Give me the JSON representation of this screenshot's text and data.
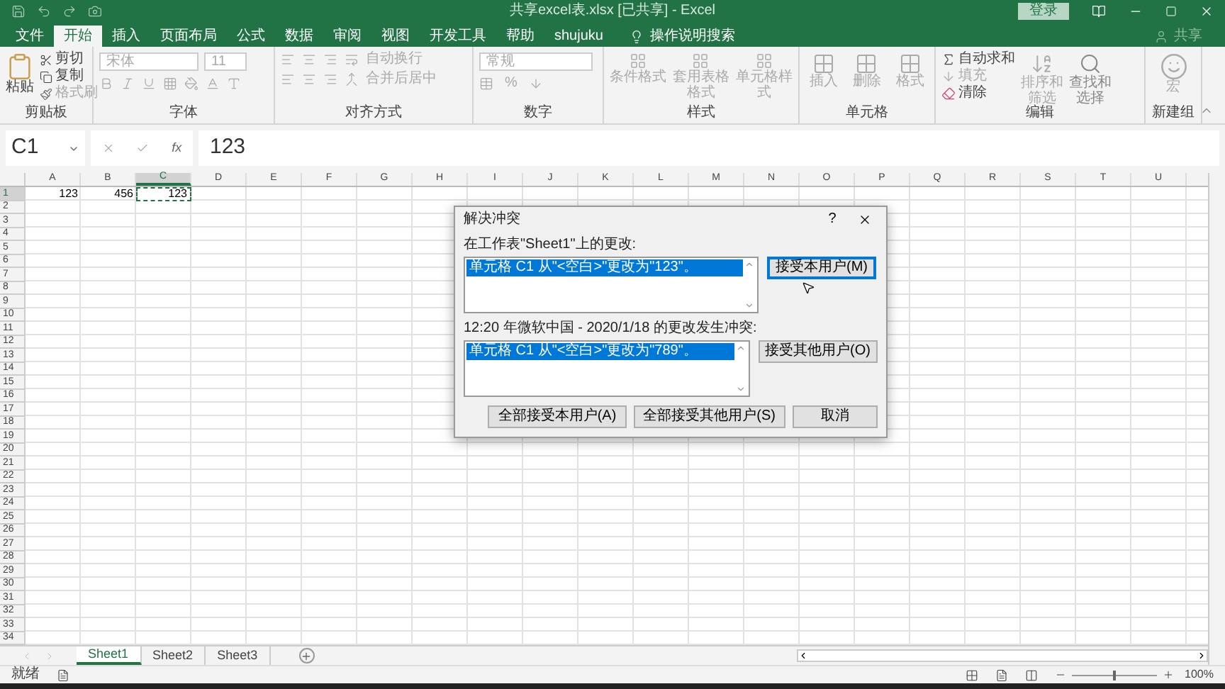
{
  "window": {
    "title": "共享excel表.xlsx  [已共享]  -  Excel",
    "sign_in": "登录"
  },
  "ribbon_tabs": [
    {
      "label": "文件",
      "selected": false
    },
    {
      "label": "开始",
      "selected": true
    },
    {
      "label": "插入",
      "selected": false
    },
    {
      "label": "页面布局",
      "selected": false
    },
    {
      "label": "公式",
      "selected": false
    },
    {
      "label": "数据",
      "selected": false
    },
    {
      "label": "审阅",
      "selected": false
    },
    {
      "label": "视图",
      "selected": false
    },
    {
      "label": "开发工具",
      "selected": false
    },
    {
      "label": "帮助",
      "selected": false
    },
    {
      "label": "shujuku",
      "selected": false
    }
  ],
  "tell_me": "操作说明搜索",
  "share": "共享",
  "clipboard": {
    "paste": "粘贴",
    "cut": "剪切",
    "copy": "复制",
    "format_painter": "格式刷",
    "label": "剪贴板"
  },
  "font": {
    "name": "宋体",
    "size": "11",
    "label": "字体"
  },
  "alignment": {
    "wrap": "自动换行",
    "merge": "合并后居中",
    "label": "对齐方式"
  },
  "number": {
    "format": "常规",
    "percent": "%",
    "label": "数字"
  },
  "styles": {
    "items": [
      "条件格式",
      "套用表格格式",
      "单元格样式"
    ],
    "label": "样式"
  },
  "cells": {
    "items": [
      "插入",
      "删除",
      "格式"
    ],
    "label": "单元格"
  },
  "editing": {
    "autosum": "自动求和",
    "fill": "填充",
    "clear": "清除",
    "sort": "排序和筛选",
    "find": "查找和选择",
    "label": "编辑"
  },
  "new_group": {
    "macro": "宏",
    "label": "新建组"
  },
  "formula_bar": {
    "name_box": "C1",
    "function_label": "fx",
    "formula": "123"
  },
  "grid": {
    "columns": [
      {
        "label": "A",
        "selected": false
      },
      {
        "label": "B",
        "selected": false
      },
      {
        "label": "C",
        "selected": true
      },
      {
        "label": "D",
        "selected": false
      },
      {
        "label": "E",
        "selected": false
      },
      {
        "label": "F",
        "selected": false
      },
      {
        "label": "G",
        "selected": false
      },
      {
        "label": "H",
        "selected": false
      },
      {
        "label": "I",
        "selected": false
      },
      {
        "label": "J",
        "selected": false
      },
      {
        "label": "K",
        "selected": false
      },
      {
        "label": "L",
        "selected": false
      },
      {
        "label": "M",
        "selected": false
      },
      {
        "label": "N",
        "selected": false
      },
      {
        "label": "O",
        "selected": false
      },
      {
        "label": "P",
        "selected": false
      },
      {
        "label": "Q",
        "selected": false
      },
      {
        "label": "R",
        "selected": false
      },
      {
        "label": "S",
        "selected": false
      },
      {
        "label": "T",
        "selected": false
      },
      {
        "label": "U",
        "selected": false
      }
    ],
    "rows": [
      {
        "number": "1",
        "selected": true,
        "cells": [
          {
            "value": "123",
            "selected": false
          },
          {
            "value": "456",
            "selected": false
          },
          {
            "value": "123",
            "selected": true
          }
        ]
      },
      {
        "number": "2",
        "selected": false
      },
      {
        "number": "3",
        "selected": false
      },
      {
        "number": "4",
        "selected": false
      },
      {
        "number": "5",
        "selected": false
      },
      {
        "number": "6",
        "selected": false
      },
      {
        "number": "7",
        "selected": false
      },
      {
        "number": "8",
        "selected": false
      },
      {
        "number": "9",
        "selected": false
      },
      {
        "number": "10",
        "selected": false
      },
      {
        "number": "11",
        "selected": false
      },
      {
        "number": "12",
        "selected": false
      },
      {
        "number": "13",
        "selected": false
      },
      {
        "number": "14",
        "selected": false
      },
      {
        "number": "15",
        "selected": false
      },
      {
        "number": "16",
        "selected": false
      },
      {
        "number": "17",
        "selected": false
      },
      {
        "number": "18",
        "selected": false
      },
      {
        "number": "19",
        "selected": false
      },
      {
        "number": "20",
        "selected": false
      },
      {
        "number": "21",
        "selected": false
      },
      {
        "number": "22",
        "selected": false
      },
      {
        "number": "23",
        "selected": false
      },
      {
        "number": "24",
        "selected": false
      },
      {
        "number": "25",
        "selected": false
      },
      {
        "number": "26",
        "selected": false
      },
      {
        "number": "27",
        "selected": false
      },
      {
        "number": "28",
        "selected": false
      },
      {
        "number": "29",
        "selected": false
      },
      {
        "number": "30",
        "selected": false
      },
      {
        "number": "31",
        "selected": false
      },
      {
        "number": "32",
        "selected": false
      },
      {
        "number": "33",
        "selected": false
      },
      {
        "number": "34",
        "selected": false
      }
    ]
  },
  "dialog": {
    "title": "解决冲突",
    "help": "?",
    "changes_label": "在工作表\"Sheet1\"上的更改:",
    "my_change": {
      "text": "单元格 C1 从\"<空白>\"更改为\"123\"。",
      "selected": true
    },
    "accept_mine": {
      "label": "接受本用户(M)",
      "focused": true
    },
    "conflict_label": "12:20 年微软中国 - 2020/1/18 的更改发生冲突:",
    "other_change": {
      "text": "单元格 C1 从\"<空白>\"更改为\"789\"。",
      "selected": true
    },
    "accept_other": {
      "label": "接受其他用户(O)",
      "focused": false
    },
    "buttons": [
      "全部接受本用户(A)",
      "全部接受其他用户(S)",
      "取消"
    ]
  },
  "sheet_tabs": [
    {
      "label": "Sheet1",
      "selected": true
    },
    {
      "label": "Sheet2",
      "selected": false
    },
    {
      "label": "Sheet3",
      "selected": false
    }
  ],
  "status_bar": {
    "status": "就绪",
    "zoom_slider": {
      "level": 0.5
    },
    "zoom": "100%"
  }
}
